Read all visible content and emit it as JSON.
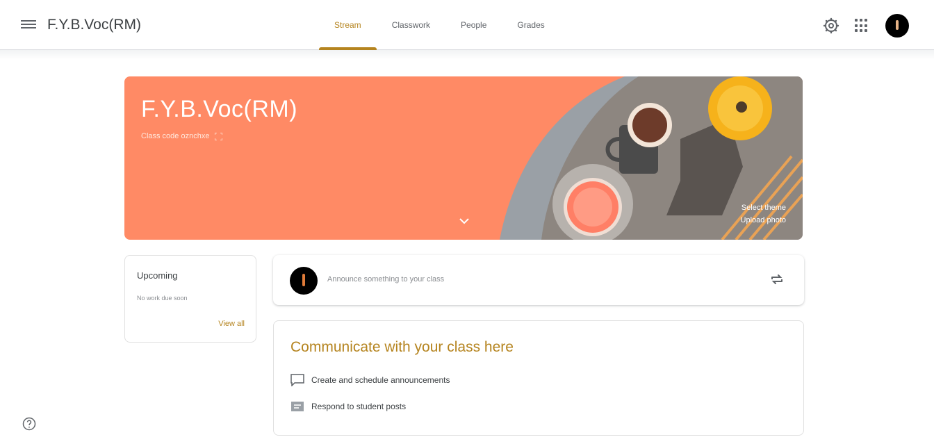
{
  "header": {
    "class_title": "F.Y.B.Voc(RM)",
    "tabs": [
      {
        "label": "Stream",
        "active": true
      },
      {
        "label": "Classwork",
        "active": false
      },
      {
        "label": "People",
        "active": false
      },
      {
        "label": "Grades",
        "active": false
      }
    ],
    "icons": [
      "menu-icon",
      "gear-icon",
      "apps-icon",
      "avatar"
    ]
  },
  "banner": {
    "title": "F.Y.B.Voc(RM)",
    "class_code_label": "Class code",
    "class_code_value": "oznchxe",
    "select_theme": "Select theme",
    "upload_photo": "Upload photo",
    "bg_color": "#ff8a65"
  },
  "upcoming": {
    "title": "Upcoming",
    "subtitle": "No work due soon",
    "view_all": "View all"
  },
  "announce": {
    "placeholder": "Announce something to your class"
  },
  "communicate": {
    "title": "Communicate with your class here",
    "items": [
      {
        "icon": "announcement-icon",
        "label": "Create and schedule announcements"
      },
      {
        "icon": "reply-icon",
        "label": "Respond to student posts"
      }
    ]
  },
  "colors": {
    "accent": "#b5841f",
    "banner": "#ff8a65"
  }
}
